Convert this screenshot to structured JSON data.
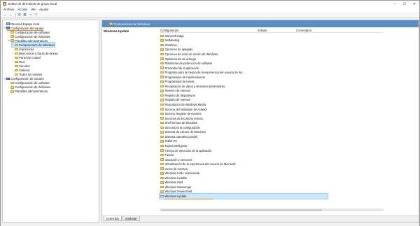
{
  "window": {
    "title": "Editor de directivas de grupo local"
  },
  "titlebar_controls": [
    "–",
    "☐",
    "✕"
  ],
  "menu": [
    "Archivo",
    "Acción",
    "Ver",
    "Ayuda"
  ],
  "toolbar": [
    "back-icon",
    "forward-icon",
    "show-hide-tree-icon",
    "properties-icon",
    "help-icon",
    "filter-icon"
  ],
  "tree": [
    {
      "label": "Directiva Equipo local",
      "depth": 0,
      "icon": "policy",
      "twisty": ""
    },
    {
      "label": "Configuración del equipo",
      "depth": 0,
      "icon": "computer",
      "twisty": "▾",
      "underline": true
    },
    {
      "label": "Configuración de software",
      "depth": 1,
      "icon": "folder",
      "twisty": "›"
    },
    {
      "label": "Configuración de Windows",
      "depth": 1,
      "icon": "folder",
      "twisty": "›"
    },
    {
      "label": "Plantillas administrativas",
      "depth": 1,
      "icon": "folder",
      "twisty": "▾",
      "underline": true
    },
    {
      "label": "Componentes de Windows",
      "depth": 2,
      "icon": "folder",
      "twisty": "›",
      "selected": true
    },
    {
      "label": "Impresoras",
      "depth": 2,
      "icon": "folder",
      "twisty": ""
    },
    {
      "label": "Menú Inicio y barra de tareas",
      "depth": 2,
      "icon": "folder",
      "twisty": "›"
    },
    {
      "label": "Panel de control",
      "depth": 2,
      "icon": "folder",
      "twisty": "›"
    },
    {
      "label": "Red",
      "depth": 2,
      "icon": "folder",
      "twisty": "›"
    },
    {
      "label": "Servidor",
      "depth": 2,
      "icon": "folder",
      "twisty": ""
    },
    {
      "label": "Sistema",
      "depth": 2,
      "icon": "folder",
      "twisty": "›"
    },
    {
      "label": "Todos los valores",
      "depth": 2,
      "icon": "folder",
      "twisty": ""
    },
    {
      "label": "Configuración de usuario",
      "depth": 0,
      "icon": "computer",
      "twisty": "▾"
    },
    {
      "label": "Configuración de software",
      "depth": 1,
      "icon": "folder",
      "twisty": "›"
    },
    {
      "label": "Configuración de Windows",
      "depth": 1,
      "icon": "folder",
      "twisty": "›"
    },
    {
      "label": "Plantillas administrativas",
      "depth": 1,
      "icon": "folder",
      "twisty": "›"
    }
  ],
  "right": {
    "header": "Componentes de Windows",
    "description_title": "Windows Update",
    "columns": [
      "Configuración",
      "Estado",
      "Comentario"
    ],
    "items": [
      {
        "label": "Microsoft Edge",
        "icon": "folder"
      },
      {
        "label": "NetMeeting",
        "icon": "folder"
      },
      {
        "label": "OneDrive",
        "icon": "folder"
      },
      {
        "label": "Opciones de apagado",
        "icon": "folder"
      },
      {
        "label": "Opciones de inicio de sesión de Windows",
        "icon": "folder"
      },
      {
        "label": "Optimización de entrega",
        "icon": "folder"
      },
      {
        "label": "Plataforma de protección de software",
        "icon": "folder"
      },
      {
        "label": "Privacidad de la aplicación",
        "icon": "folder"
      },
      {
        "label": "Programa para la mejora de la experiencia del usuario de Wi...",
        "icon": "folder"
      },
      {
        "label": "Programador de mantenimiento",
        "icon": "folder"
      },
      {
        "label": "Programador de tareas",
        "icon": "folder"
      },
      {
        "label": "Recopilación de datos y versiones preliminares",
        "icon": "folder"
      },
      {
        "label": "Reenvío de eventos",
        "icon": "folder"
      },
      {
        "label": "Registro de dispositivos",
        "icon": "folder"
      },
      {
        "label": "Registro de eventos",
        "icon": "folder"
      },
      {
        "label": "Reproductor de Windows Media",
        "icon": "folder"
      },
      {
        "label": "Servicio del instalador de ActiveX",
        "icon": "folder"
      },
      {
        "label": "Servicio Registro de eventos",
        "icon": "folder"
      },
      {
        "label": "Servicios de Escritorio remoto",
        "icon": "folder"
      },
      {
        "label": "Shell remoto de Windows",
        "icon": "folder"
      },
      {
        "label": "Sincronizar la configuración",
        "icon": "folder"
      },
      {
        "label": "Sistema de colores de Windows",
        "icon": "folder"
      },
      {
        "label": "Sistema operativo portátil",
        "icon": "folder"
      },
      {
        "label": "Tablet PC",
        "icon": "folder"
      },
      {
        "label": "Tarjeta inteligente",
        "icon": "folder"
      },
      {
        "label": "Tiempo de ejecución de la aplicación",
        "icon": "folder"
      },
      {
        "label": "Tienda",
        "icon": "folder"
      },
      {
        "label": "Ubicación y sensores",
        "icon": "folder"
      },
      {
        "label": "Virtualización de la experiencia del usuario de Microsoft",
        "icon": "folder"
      },
      {
        "label": "Voces de eventos",
        "icon": "folder"
      },
      {
        "label": "Windows Hello empresarial",
        "icon": "folder"
      },
      {
        "label": "Windows Installer",
        "icon": "folder"
      },
      {
        "label": "Windows Mail",
        "icon": "folder"
      },
      {
        "label": "Windows Messenger",
        "icon": "folder"
      },
      {
        "label": "Windows PowerShell",
        "icon": "folder"
      },
      {
        "label": "Windows Update",
        "icon": "settings",
        "selected": true,
        "underline": true
      }
    ],
    "tabs": [
      "Extendido",
      "Estándar"
    ]
  },
  "colors": {
    "header_bg": "#5a8cc5",
    "selection": "#cce8ff",
    "underline": "#f08a24",
    "folder": "#f2cf6b"
  }
}
